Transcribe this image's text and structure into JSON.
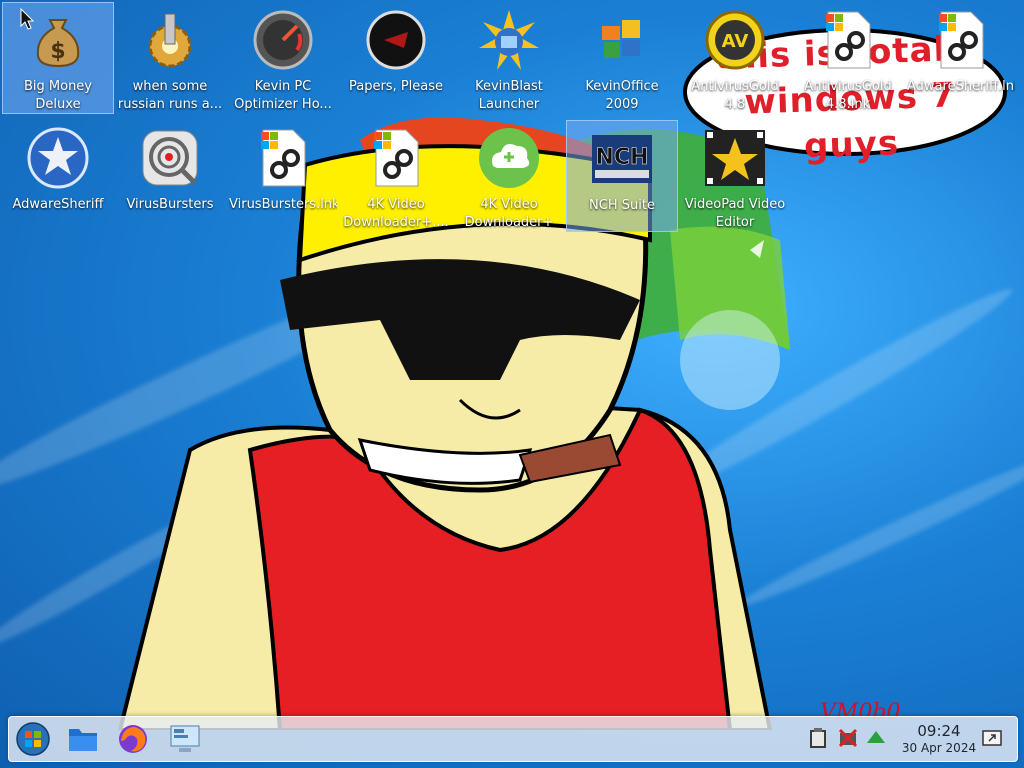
{
  "desktop": {
    "icons": [
      {
        "label": "Big Money Deluxe",
        "icon": "money-bag-icon"
      },
      {
        "label": "when some russian runs a...",
        "icon": "gear-icon"
      },
      {
        "label": "Kevin PC Optimizer Ho...",
        "icon": "gauge-icon"
      },
      {
        "label": "Papers, Please",
        "icon": "papers-please-icon"
      },
      {
        "label": "KevinBlast Launcher",
        "icon": "globe-burst-icon"
      },
      {
        "label": "KevinOffice 2009",
        "icon": "office-icon"
      },
      {
        "label": "AntivirusGold 4.8",
        "icon": "av-icon"
      },
      {
        "label": "AntivirusGold 4.8.lnk",
        "icon": "shortcut-file-icon"
      },
      {
        "label": "AdwareSheriff.lnk",
        "icon": "shortcut-file-icon"
      },
      {
        "label": "AdwareSheriff",
        "icon": "sheriff-star-icon"
      },
      {
        "label": "VirusBursters",
        "icon": "target-icon"
      },
      {
        "label": "VirusBursters.lnk",
        "icon": "shortcut-file-icon"
      },
      {
        "label": "4K Video Downloader+....",
        "icon": "shortcut-file-icon"
      },
      {
        "label": "4K Video Downloader+",
        "icon": "cloud-download-icon"
      },
      {
        "label": "NCH Suite",
        "icon": "nch-icon"
      },
      {
        "label": "VideoPad Video Editor",
        "icon": "film-star-icon"
      }
    ]
  },
  "wallpaper": {
    "bubble_text": "this is totally windows 7 guys",
    "vm_label": "VM0b0"
  },
  "taskbar": {
    "start": "start-orb-icon",
    "pinned": [
      "file-manager-icon",
      "firefox-icon",
      "system-settings-icon"
    ],
    "tray": [
      "clipboard-icon",
      "network-disconnected-icon",
      "updates-arrow-icon",
      "show-desktop-icon"
    ],
    "clock": {
      "time": "09:24",
      "date": "30 Apr 2024"
    }
  },
  "colors": {
    "desktop_blue": "#1a7fd4",
    "bubble_red": "#e01f2a",
    "taskbar": "#e6ecf4",
    "selection": "#78aaf0"
  }
}
